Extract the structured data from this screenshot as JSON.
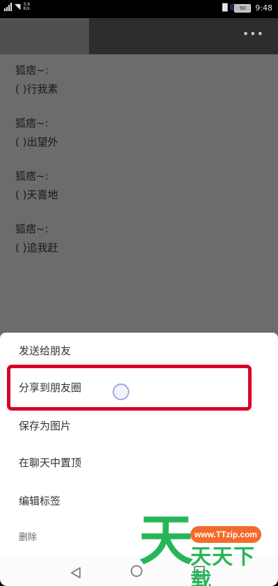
{
  "status_bar": {
    "network_speed_value": "3.9",
    "network_speed_unit": "K/s",
    "battery": "90",
    "time": "9:48"
  },
  "app_bar": {
    "more_icon": "more-dots-icon"
  },
  "messages": [
    {
      "sender": "狐痞~:",
      "text": "( )行我素"
    },
    {
      "sender": "狐痞~:",
      "text": "( )出望外"
    },
    {
      "sender": "狐痞~:",
      "text": "( )天喜地"
    },
    {
      "sender": "狐痞~:",
      "text": "( )追我赶"
    }
  ],
  "menu": {
    "items": [
      "发送给朋友",
      "分享到朋友圈",
      "保存为图片",
      "在聊天中置顶",
      "编辑标签",
      "删除"
    ],
    "highlight_color": "#d6002a"
  },
  "watermark": {
    "big_char": "天",
    "url": "www.TTzip.com",
    "text": "天天下载"
  }
}
